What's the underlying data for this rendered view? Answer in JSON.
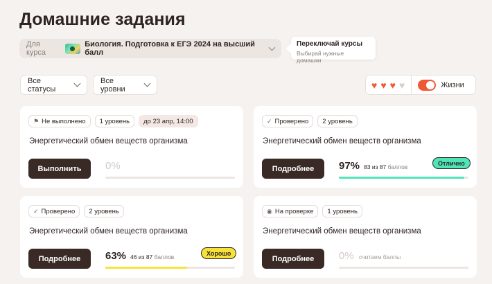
{
  "page": {
    "title": "Домашние задания",
    "course_prefix": "Для курса",
    "course_name": "Биология. Подготовка к ЕГЭ 2024 на высший балл",
    "tooltip": {
      "title": "Переключай курсы",
      "text": "Выбирай нужные домашки"
    }
  },
  "filters": {
    "status": "Все статусы",
    "level": "Все уровни"
  },
  "lives": {
    "filled": 3,
    "total": 4,
    "label": "Жизни",
    "enabled": true
  },
  "colors": {
    "accent": "#ef5a34",
    "button": "#3a2a26",
    "green": "#4ee6b8",
    "yellow": "#f7e23a"
  },
  "cards": [
    {
      "status": "Не выполнено",
      "status_icon": "flag-icon",
      "level": "1 уровень",
      "deadline": "до 23 апр, 14:00",
      "title": "Энергетический обмен веществ организма",
      "button": "Выполнить",
      "percent": "0%",
      "progress": 0,
      "score": "",
      "score_unit": "",
      "badge": ""
    },
    {
      "status": "Проверено",
      "status_icon": "check-icon",
      "level": "2 уровень",
      "deadline": "",
      "title": "Энергетический обмен веществ организма",
      "button": "Подробнее",
      "percent": "97%",
      "progress": 97,
      "score": "83 из 87",
      "score_unit": "баллов",
      "badge": "Отлично"
    },
    {
      "status": "Проверено",
      "status_icon": "check-icon",
      "level": "2 уровень",
      "deadline": "",
      "title": "Энергетический обмен веществ организма",
      "button": "Подробнее",
      "percent": "63%",
      "progress": 63,
      "score": "46 из 87",
      "score_unit": "баллов",
      "badge": "Хорошо"
    },
    {
      "status": "На проверке",
      "status_icon": "eye-icon",
      "level": "1 уровень",
      "deadline": "",
      "title": "Энергетический обмен веществ организма",
      "button": "Подробнее",
      "percent": "0%",
      "progress": 0,
      "score": "считаем баллы",
      "score_unit": "",
      "badge": ""
    }
  ]
}
